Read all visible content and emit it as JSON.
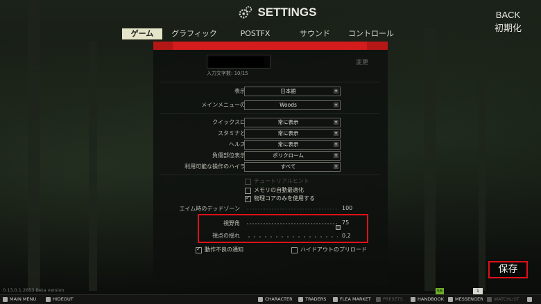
{
  "header": {
    "title": "SETTINGS",
    "back": "BACK",
    "reset": "初期化"
  },
  "tabs": [
    {
      "label": "ゲーム",
      "active": true
    },
    {
      "label": "グラフィック"
    },
    {
      "label": "POSTFX"
    },
    {
      "label": "サウンド"
    },
    {
      "label": "コントロール"
    }
  ],
  "profile": {
    "change_label": "変更",
    "char_count": "入力文字数: 10/15"
  },
  "settings": {
    "language": {
      "label": "表示言語",
      "value": "日本語"
    },
    "main_menu_bg": {
      "label": "メインメニューの背景",
      "value": "Woods"
    },
    "quick_slot": {
      "label": "クイックスロット",
      "value": "常に表示"
    },
    "stamina": {
      "label": "スタミナと姿勢",
      "value": "常に表示"
    },
    "health": {
      "label": "ヘルス状態",
      "value": "常に表示"
    },
    "injury_color": {
      "label": "負傷部位表示の色",
      "value": "ポリクローム"
    },
    "highlight": {
      "label": "利用可能な操作のハイライト",
      "value": "すべて"
    }
  },
  "checkboxes": {
    "tutorial": {
      "label": "チュートリアルヒント",
      "checked": false,
      "disabled": true
    },
    "auto_ram": {
      "label": "メモリの自動最適化",
      "checked": false
    },
    "physical_cores": {
      "label": "物理コアのみを使用する",
      "checked": true
    },
    "malfunction_notice": {
      "label": "動作不良の通知",
      "checked": true
    },
    "hideout_preload": {
      "label": "ハイドアウトのプリロード",
      "checked": false
    }
  },
  "sliders": {
    "aim_deadzone": {
      "label": "エイム時のデッドゾーン",
      "value": "100",
      "disabled": true
    },
    "fov": {
      "label": "視野角",
      "value": "75"
    },
    "head_bob": {
      "label": "視点の揺れ",
      "value": "0.2"
    }
  },
  "save_label": "保存",
  "version": "0.13.0.1.2653 Beta version",
  "indicators": {
    "green": "56",
    "white": "1"
  },
  "bottom_bar": {
    "main_menu": "MAIN MENU",
    "hideout": "HIDEOUT",
    "character": "CHARACTER",
    "traders": "TRADERS",
    "flea_market": "FLEA MARKET",
    "presets": "PRESETS",
    "handbook": "HANDBOOK",
    "messenger": "MESSENGER",
    "watchlist": "WATCHLIST"
  },
  "colors": {
    "accent_red": "#e0101a",
    "tab_active": "#e5e3c8"
  }
}
